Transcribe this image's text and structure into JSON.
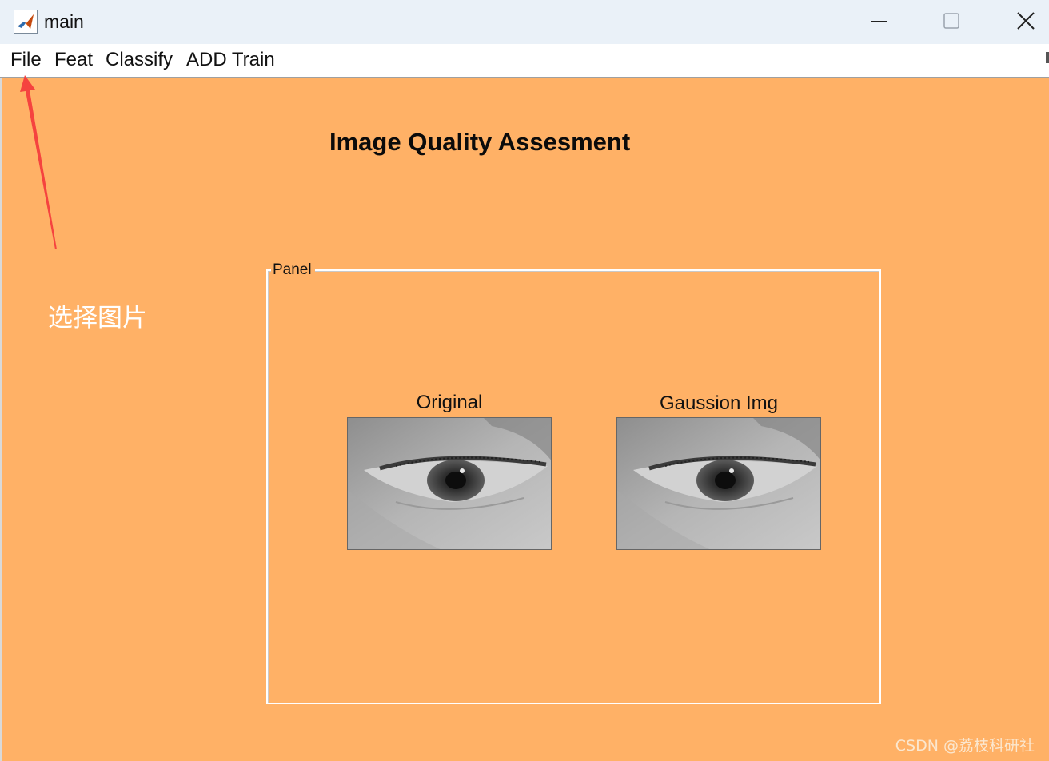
{
  "window": {
    "title": "main",
    "icon": "matlab-icon",
    "controls": [
      "minimize-icon",
      "maximize-icon",
      "close-icon"
    ]
  },
  "menubar": {
    "items": [
      {
        "label": "File"
      },
      {
        "label": "Feat"
      },
      {
        "label": "Classify"
      },
      {
        "label": "ADD Train"
      }
    ]
  },
  "main": {
    "heading": "Image Quality Assesment",
    "background_color": "#ffb166",
    "panel": {
      "title": "Panel",
      "images": [
        {
          "caption": "Original",
          "content": "grayscale eye photo"
        },
        {
          "caption": "Gaussion Img",
          "content": "grayscale eye photo"
        }
      ]
    }
  },
  "annotation": {
    "label": "选择图片",
    "arrow_color": "#f5433f"
  },
  "watermark": "CSDN @荔枝科研社"
}
